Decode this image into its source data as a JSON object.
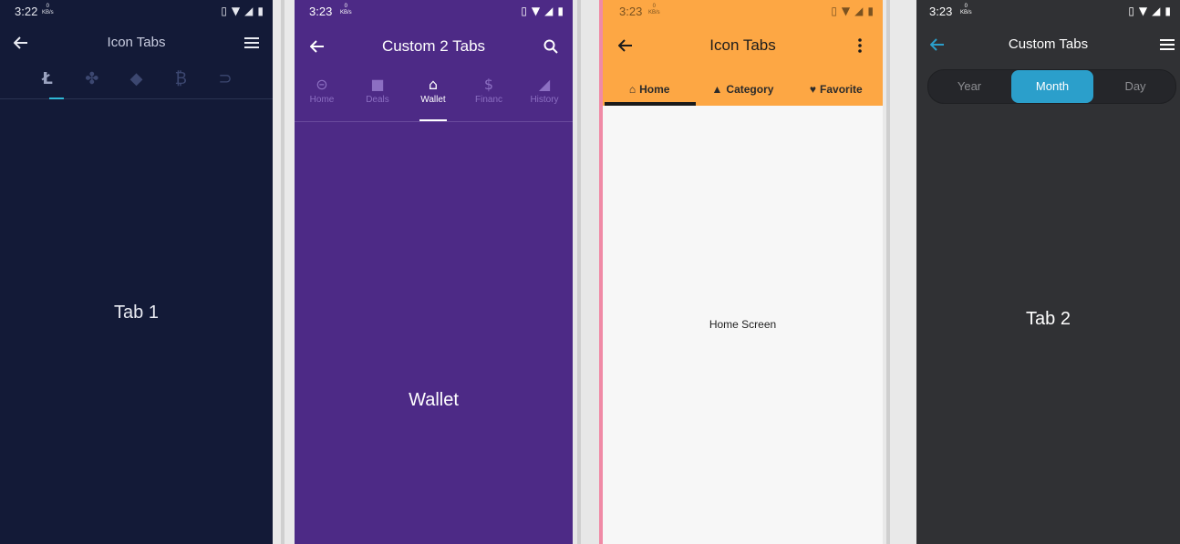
{
  "phone1": {
    "status": {
      "time": "3:22",
      "kb_top": "0",
      "kb_bottom": "KB/s"
    },
    "title": "Icon Tabs",
    "tab_icons": [
      "litecoin-icon",
      "ripple-icon",
      "ethereum-icon",
      "bitcoin-icon",
      "dash-icon"
    ],
    "active_tab": 0,
    "content": "Tab 1",
    "colors": {
      "background": "#131a37",
      "indicator": "#2fb8d6"
    }
  },
  "phone2": {
    "status": {
      "time": "3:23",
      "kb_top": "0",
      "kb_bottom": "KB/s"
    },
    "title": "Custom 2 Tabs",
    "tabs": [
      {
        "label": "Home",
        "icon": "minus-circle-icon"
      },
      {
        "label": "Deals",
        "icon": "briefcase-icon"
      },
      {
        "label": "Wallet",
        "icon": "bank-icon"
      },
      {
        "label": "Financ",
        "icon": "dollar-circle-icon"
      },
      {
        "label": "History",
        "icon": "signal-icon"
      }
    ],
    "active_tab": 2,
    "content": "Wallet",
    "colors": {
      "background": "#4d2a86",
      "indicator": "#ffffff"
    }
  },
  "phone3": {
    "status": {
      "time": "3:23",
      "kb_top": "0",
      "kb_bottom": "KB/s"
    },
    "title": "Icon Tabs",
    "tabs": [
      {
        "label": "Home",
        "icon": "home-icon"
      },
      {
        "label": "Category",
        "icon": "category-icon"
      },
      {
        "label": "Favorite",
        "icon": "heart-icon"
      }
    ],
    "active_tab": 0,
    "content": "Home Screen",
    "colors": {
      "appbar": "#fda744",
      "indicator": "#1a1a1a"
    }
  },
  "phone4": {
    "status": {
      "time": "3:23",
      "kb_top": "0",
      "kb_bottom": "KB/s"
    },
    "title": "Custom Tabs",
    "segments": [
      "Year",
      "Month",
      "Day"
    ],
    "active_segment": 1,
    "content": "Tab 2",
    "colors": {
      "background": "#303134",
      "accent": "#2b9fcb"
    }
  }
}
